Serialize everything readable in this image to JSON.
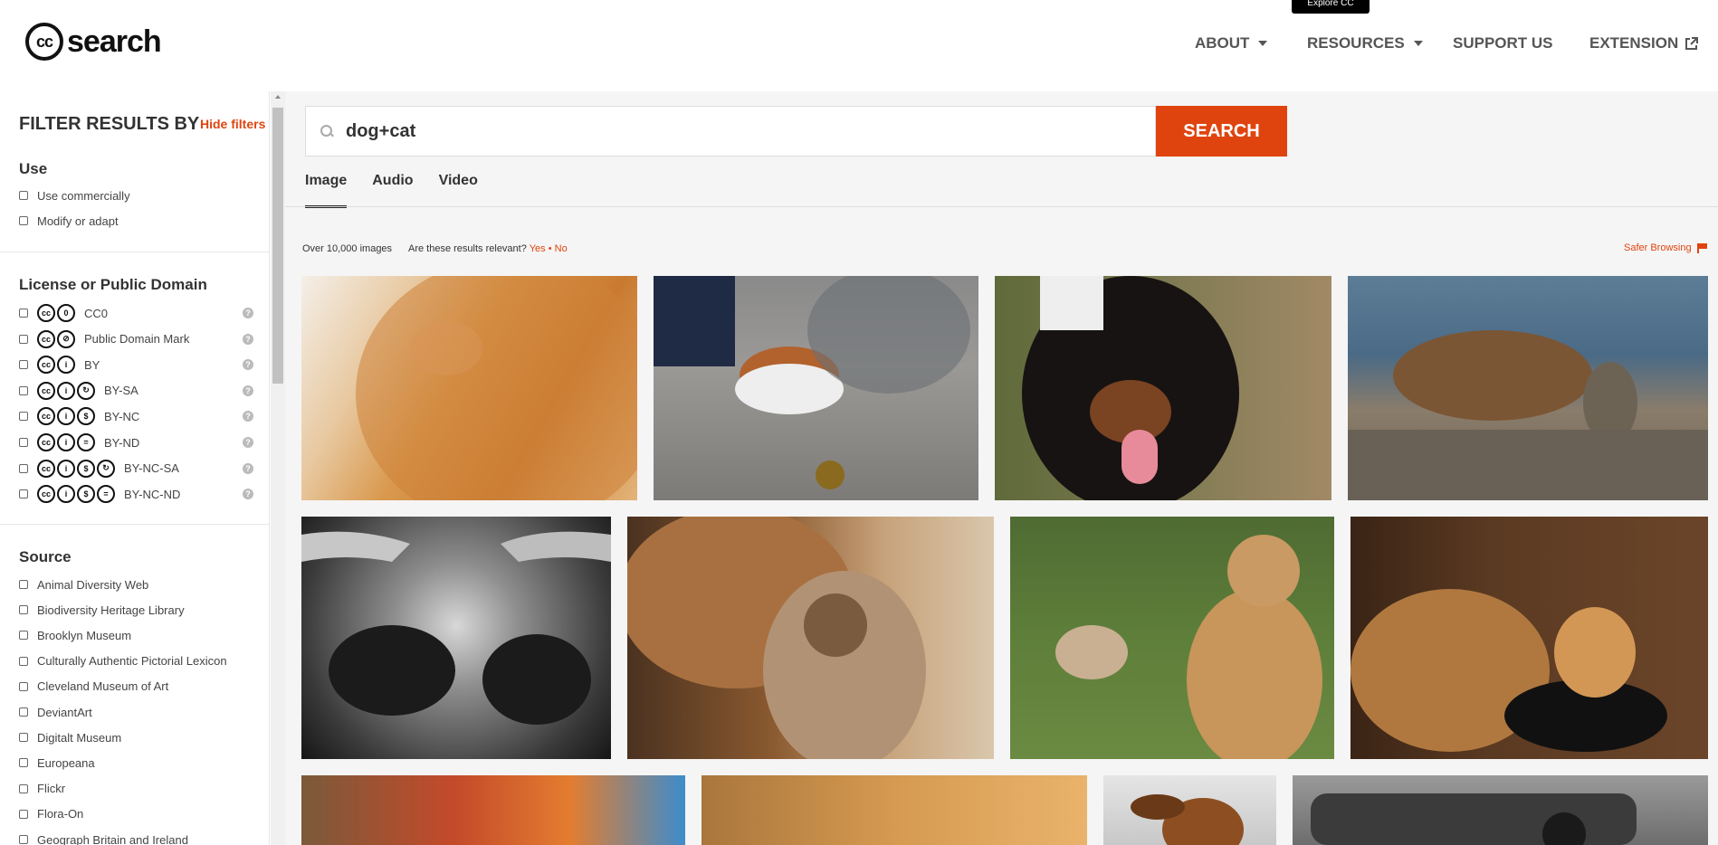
{
  "header": {
    "logo_text": "search",
    "logo_cc": "cc",
    "tooltip": "Explore CC",
    "nav": [
      {
        "label": "ABOUT",
        "dropdown": true
      },
      {
        "label": "RESOURCES",
        "dropdown": true
      },
      {
        "label": "SUPPORT US",
        "dropdown": false
      },
      {
        "label": "EXTENSION",
        "dropdown": false
      }
    ]
  },
  "sidebar": {
    "title": "FILTER RESULTS BY",
    "hide_filters": "Hide filters",
    "use": {
      "heading": "Use",
      "items": [
        "Use commercially",
        "Modify or adapt"
      ]
    },
    "license": {
      "heading": "License or Public Domain",
      "items": [
        {
          "label": "CC0",
          "icons": [
            "cc",
            "0"
          ]
        },
        {
          "label": "Public Domain Mark",
          "icons": [
            "cc",
            "pd"
          ]
        },
        {
          "label": "BY",
          "icons": [
            "cc",
            "by"
          ]
        },
        {
          "label": "BY-SA",
          "icons": [
            "cc",
            "by",
            "sa"
          ]
        },
        {
          "label": "BY-NC",
          "icons": [
            "cc",
            "by",
            "nc"
          ]
        },
        {
          "label": "BY-ND",
          "icons": [
            "cc",
            "by",
            "nd"
          ]
        },
        {
          "label": "BY-NC-SA",
          "icons": [
            "cc",
            "by",
            "nc",
            "sa"
          ]
        },
        {
          "label": "BY-NC-ND",
          "icons": [
            "cc",
            "by",
            "nc",
            "nd"
          ]
        }
      ]
    },
    "source": {
      "heading": "Source",
      "items": [
        "Animal Diversity Web",
        "Biodiversity Heritage Library",
        "Brooklyn Museum",
        "Culturally Authentic Pictorial Lexicon",
        "Cleveland Museum of Art",
        "DeviantArt",
        "Digitalt Museum",
        "Europeana",
        "Flickr",
        "Flora-On",
        "Geograph Britain and Ireland"
      ]
    }
  },
  "search": {
    "value": "dog+cat",
    "button": "SEARCH"
  },
  "tabs": [
    "Image",
    "Audio",
    "Video"
  ],
  "results": {
    "count": "Over 10,000 images",
    "relevance_question": "Are these results relevant?",
    "yes": "Yes",
    "separator": "•",
    "no": "No",
    "safer_browsing": "Safer Browsing"
  },
  "images": [
    {
      "name": "orange-cat-closeup"
    },
    {
      "name": "dog-and-cat-on-pavement"
    },
    {
      "name": "rottweiler-tongue"
    },
    {
      "name": "dog-and-cat-on-rocks"
    },
    {
      "name": "hands-bw"
    },
    {
      "name": "dog-nuzzling-cat"
    },
    {
      "name": "calico-cat-and-golden-dog"
    },
    {
      "name": "golden-dog-and-kitten"
    },
    {
      "name": "colorful-room"
    },
    {
      "name": "cat-in-chair"
    },
    {
      "name": "beagle-jumping"
    },
    {
      "name": "car-on-street"
    }
  ],
  "colors": {
    "accent": "#e0440e"
  }
}
